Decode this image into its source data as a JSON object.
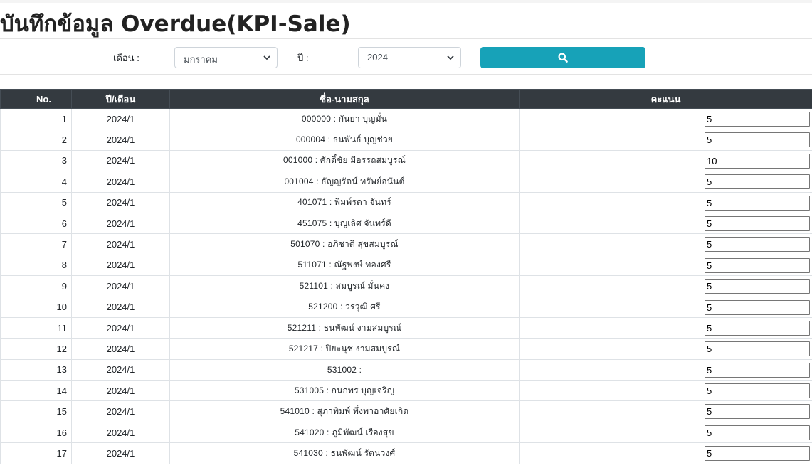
{
  "page": {
    "title": "บันทึกข้อมูล Overdue(KPI-Sale)"
  },
  "filters": {
    "month_label": "เดือน :",
    "month_value": "มกราคม",
    "year_label": "ปี :",
    "year_value": "2024",
    "search_icon": "search-icon",
    "accent_color": "#17a2b8"
  },
  "table": {
    "headers": {
      "no": "No.",
      "period": "ปี/เดือน",
      "name": "ชื่อ-นามสกุล",
      "score": "คะแนน"
    },
    "header_bg": "#343a40",
    "rows": [
      {
        "no": "1",
        "period": "2024/1",
        "name": "000000 : กันยา บุญมั่น",
        "score": "5"
      },
      {
        "no": "2",
        "period": "2024/1",
        "name": "000004 : ธนพันธ์ บุญช่วย",
        "score": "5"
      },
      {
        "no": "3",
        "period": "2024/1",
        "name": "001000 : ศักดิ์ชัย มีอรรถสมบูรณ์",
        "score": "10"
      },
      {
        "no": "4",
        "period": "2024/1",
        "name": "001004 : ธัญญรัตน์ ทรัพย์อนันต์",
        "score": "5"
      },
      {
        "no": "5",
        "period": "2024/1",
        "name": "401071 : พิมพ์รดา จันทร์",
        "score": "5"
      },
      {
        "no": "6",
        "period": "2024/1",
        "name": "451075 : บุญเลิศ จันทร์ดี",
        "score": "5"
      },
      {
        "no": "7",
        "period": "2024/1",
        "name": "501070 : อภิชาติ สุขสมบูรณ์",
        "score": "5"
      },
      {
        "no": "8",
        "period": "2024/1",
        "name": "511071 : ณัฐพงษ์ ทองศรี",
        "score": "5"
      },
      {
        "no": "9",
        "period": "2024/1",
        "name": "521101 : สมบูรณ์ มั่นคง",
        "score": "5"
      },
      {
        "no": "10",
        "period": "2024/1",
        "name": "521200 : วรวุฒิ ศรี",
        "score": "5"
      },
      {
        "no": "11",
        "period": "2024/1",
        "name": "521211 : ธนพัฒน์ งามสมบูรณ์",
        "score": "5"
      },
      {
        "no": "12",
        "period": "2024/1",
        "name": "521217 : ปิยะนุช งามสมบูรณ์",
        "score": "5"
      },
      {
        "no": "13",
        "period": "2024/1",
        "name": "531002 :",
        "score": "5"
      },
      {
        "no": "14",
        "period": "2024/1",
        "name": "531005 : กนกพร บุญเจริญ",
        "score": "5"
      },
      {
        "no": "15",
        "period": "2024/1",
        "name": "541010 : สุภาพิมพ์ พึ่งพาอาศัยเกิด",
        "score": "5"
      },
      {
        "no": "16",
        "period": "2024/1",
        "name": "541020 : ภูมิพัฒน์ เรืองสุข",
        "score": "5"
      },
      {
        "no": "17",
        "period": "2024/1",
        "name": "541030 : ธนพัฒน์ รัตนวงศ์",
        "score": "5"
      }
    ]
  }
}
